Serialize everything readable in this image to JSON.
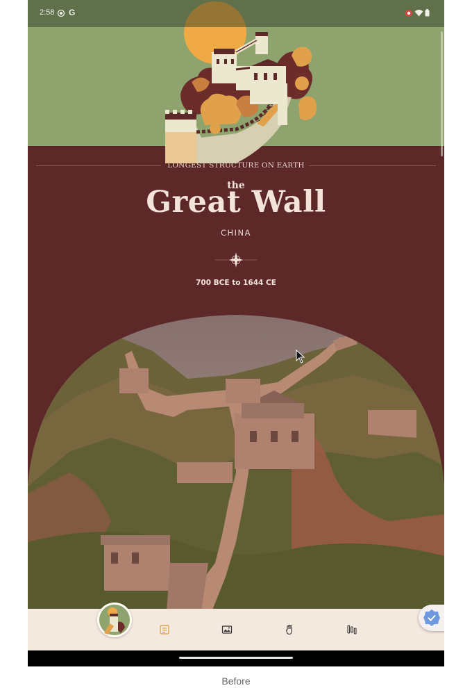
{
  "status_bar": {
    "time": "2:58",
    "icons_left": [
      "location-target-icon",
      "google-icon"
    ],
    "icons_right": [
      "screen-record-icon",
      "wifi-icon",
      "battery-icon"
    ]
  },
  "header": {
    "tagline": "LONGEST STRUCTURE ON EARTH",
    "title_prefix": "the",
    "title": "Great Wall",
    "country": "CHINA",
    "dates": "700 BCE to 1644 CE"
  },
  "bottom_nav": {
    "items": [
      {
        "name": "home-thumbnail",
        "icon": "great-wall-thumbnail"
      },
      {
        "name": "facts",
        "icon": "scroll-icon"
      },
      {
        "name": "photos",
        "icon": "image-icon"
      },
      {
        "name": "artifacts",
        "icon": "hand-icon"
      },
      {
        "name": "timeline",
        "icon": "timeline-icon"
      }
    ]
  },
  "fab": {
    "icon": "check-shield-icon"
  },
  "caption": "Before",
  "colors": {
    "sky": "#8ea36d",
    "background": "#5d2828",
    "sun": "#f0aa45",
    "text_light": "#f3e4da",
    "nav_bg": "#f4e9df",
    "nav_icon": "#e0a64f"
  }
}
